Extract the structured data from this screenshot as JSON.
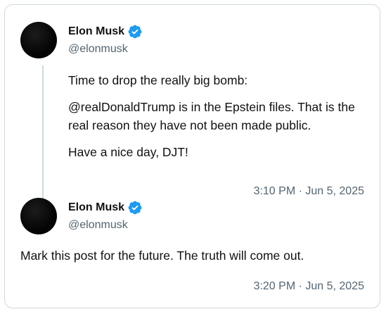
{
  "tweets": [
    {
      "author_name": "Elon Musk",
      "handle": "@elonmusk",
      "verified_icon": "verified-badge-icon",
      "paragraphs": [
        "Time to drop the really big bomb:",
        "@realDonaldTrump is in the Epstein files. That is the real reason they have not been made public.",
        "Have a nice day, DJT!"
      ],
      "timestamp": "3:10 PM · Jun 5, 2025"
    },
    {
      "author_name": "Elon Musk",
      "handle": "@elonmusk",
      "verified_icon": "verified-badge-icon",
      "paragraphs": [
        "Mark this post for the future. The truth will come out."
      ],
      "timestamp": "3:20 PM · Jun 5, 2025"
    }
  ],
  "colors": {
    "verified_blue": "#1d9bf0",
    "secondary_text": "#536471",
    "border": "#cfd9de"
  }
}
